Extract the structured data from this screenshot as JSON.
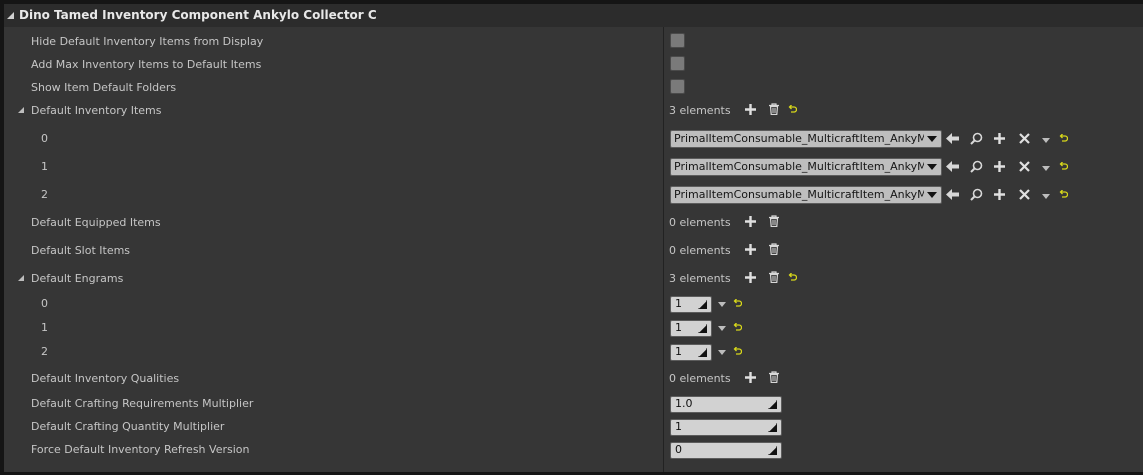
{
  "header": {
    "title": "Dino Tamed Inventory Component Ankylo Collector C"
  },
  "rows": {
    "hide_default_items": {
      "label": "Hide Default Inventory Items from Display",
      "checked": false
    },
    "add_max_items": {
      "label": "Add Max Inventory Items to Default Items",
      "checked": false
    },
    "show_default_folders": {
      "label": "Show Item Default Folders",
      "checked": false
    },
    "default_inventory_items": {
      "label": "Default Inventory Items",
      "count": "3 elements",
      "elements": [
        {
          "index": "0",
          "value": "PrimalItemConsumable_MulticraftItem_AnkyMeta"
        },
        {
          "index": "1",
          "value": "PrimalItemConsumable_MulticraftItem_AnkyMeta"
        },
        {
          "index": "2",
          "value": "PrimalItemConsumable_MulticraftItem_AnkyMeta"
        }
      ]
    },
    "default_equipped_items": {
      "label": "Default Equipped Items",
      "count": "0 elements"
    },
    "default_slot_items": {
      "label": "Default Slot Items",
      "count": "0 elements"
    },
    "default_engrams": {
      "label": "Default Engrams",
      "count": "3 elements",
      "elements": [
        {
          "index": "0",
          "value": "1"
        },
        {
          "index": "1",
          "value": "1"
        },
        {
          "index": "2",
          "value": "1"
        }
      ]
    },
    "default_inventory_qualities": {
      "label": "Default Inventory Qualities",
      "count": "0 elements"
    },
    "crafting_req_multiplier": {
      "label": "Default Crafting Requirements Multiplier",
      "value": "1.0"
    },
    "crafting_qty_multiplier": {
      "label": "Default Crafting Quantity Multiplier",
      "value": "1"
    },
    "refresh_version": {
      "label": "Force Default Inventory Refresh Version",
      "value": "0"
    }
  },
  "icons": {
    "add": "plus-icon",
    "delete": "trash-icon",
    "reset": "reset-arrow-icon",
    "use_selected": "arrow-left-icon",
    "browse": "magnifier-icon",
    "clear": "x-icon",
    "options": "dropdown-arrow-icon"
  },
  "colors": {
    "panel": "#363636",
    "header": "#2c2c2c",
    "reset_accent": "#d8d81a",
    "text": "#c6c6c6"
  }
}
